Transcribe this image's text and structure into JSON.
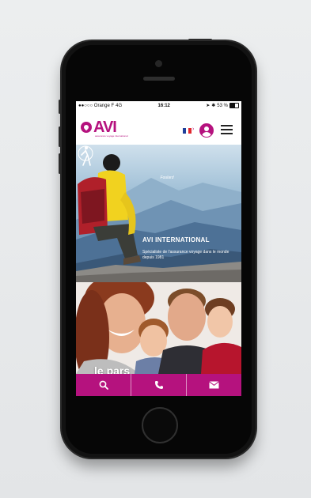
{
  "statusbar": {
    "carrier": "●●○○○ Orange F",
    "network": "4G",
    "time": "16:12",
    "battery": "53 %"
  },
  "header": {
    "logo_text": "AVI",
    "logo_tagline": "assurance voyage international",
    "brand_color": "#b5127e",
    "language_flag": "fr-flag-icon",
    "user_icon": "user-icon",
    "menu_icon": "hamburger-icon"
  },
  "hero": {
    "badge_label": "Foulard",
    "title": "AVI INTERNATIONAL",
    "description": "Spécialiste de l'assurance voyage dans le monde depuis 1981"
  },
  "family": {
    "partial_text": "le pars"
  },
  "bottom_bar": {
    "items": [
      {
        "icon": "search-icon"
      },
      {
        "icon": "phone-icon"
      },
      {
        "icon": "mail-icon"
      }
    ]
  }
}
